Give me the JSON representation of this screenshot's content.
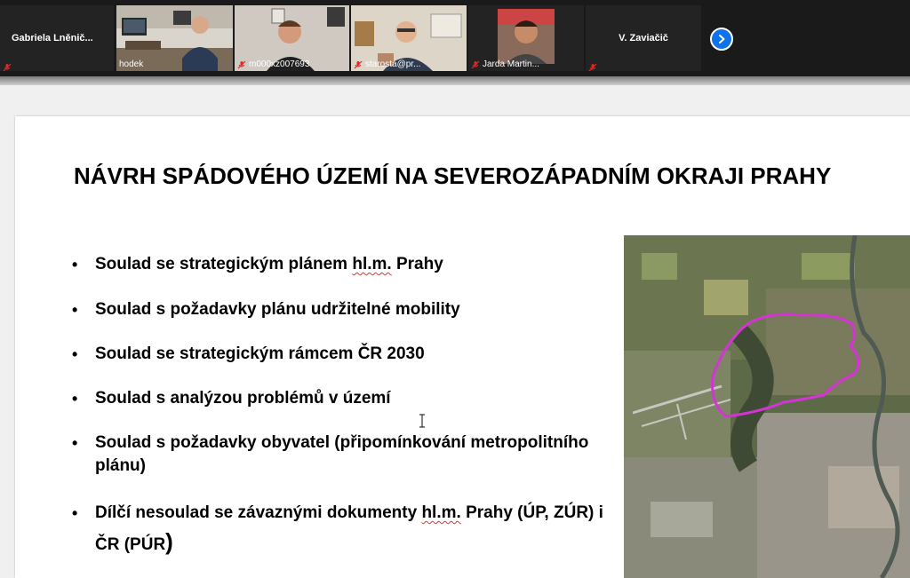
{
  "participants": [
    {
      "name": "Gabriela  Lněnič...",
      "video": false,
      "muted": true
    },
    {
      "name": "hodek",
      "video": true,
      "muted": false,
      "active_speaker": true
    },
    {
      "name": "m000xz007693",
      "video": true,
      "muted": true
    },
    {
      "name": "starosta@pr...",
      "video": true,
      "muted": true
    },
    {
      "name": "Jarda Martin...",
      "video": true,
      "muted": true
    },
    {
      "name": "V. Zaviačič",
      "video": false,
      "muted": false
    },
    {
      "name": "",
      "video": false,
      "muted": true
    }
  ],
  "controls": {
    "next_icon": "chevron-right-icon"
  },
  "slide": {
    "title": "NÁVRH SPÁDOVÉHO ÚZEMÍ NA SEVEROZÁPADNÍM OKRAJI PRAHY",
    "bullets": {
      "b1_pre": "Soulad se strategickým plánem ",
      "b1_sq": "hl.m.",
      "b1_post": " Prahy",
      "b2": "Soulad s požadavky plánu udržitelné mobility",
      "b3": "Soulad se strategickým rámcem ČR 2030",
      "b4": "Soulad s analýzou problémů v území",
      "b5": "Soulad s požadavky obyvatel (připomínkování metropolitního plánu)",
      "b6_pre": "Dílčí nesoulad se závaznými dokumenty ",
      "b6_sq": "hl.m.",
      "b6_mid": " Prahy (ÚP, ZÚR) i ČR (PÚR",
      "b6_paren": ")"
    },
    "map_icon": "satellite-map-image",
    "highlight_color": "#d633d6"
  },
  "colors": {
    "strip_bg": "#1a1a1a",
    "accent_blue": "#0e72ed",
    "mute_red": "#e02828"
  }
}
